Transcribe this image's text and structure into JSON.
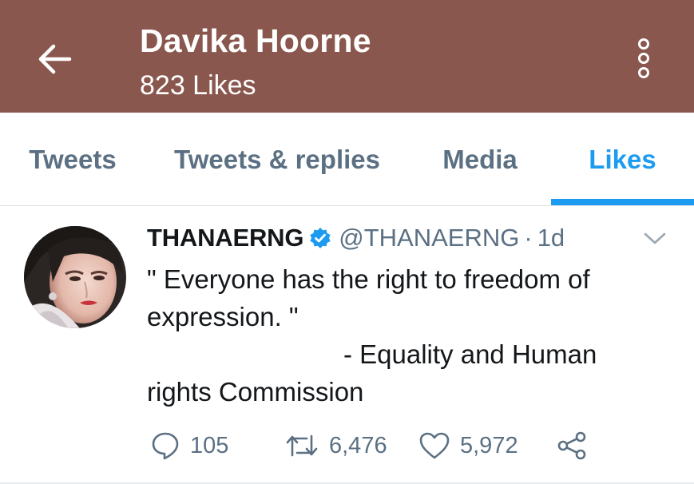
{
  "header": {
    "title": "Davika Hoorne",
    "subtitle": "823 Likes",
    "background_color": "#8a574e",
    "back_icon": "arrow-left-icon",
    "more_icon": "more-vertical-icon"
  },
  "tabs": [
    {
      "label": "Tweets",
      "active": false
    },
    {
      "label": "Tweets & replies",
      "active": false
    },
    {
      "label": "Media",
      "active": false
    },
    {
      "label": "Likes",
      "active": true
    }
  ],
  "accent_color": "#1d9bf0",
  "tweet": {
    "author_name": "THANAERNG",
    "verified": true,
    "handle": "@THANAERNG",
    "separator": "·",
    "time": "1d",
    "text_lines": [
      "\" Everyone has the right to freedom of",
      "expression. \"",
      "- Equality and Human",
      "rights Commission"
    ],
    "replies": "105",
    "retweets": "6,476",
    "likes": "5,972"
  }
}
